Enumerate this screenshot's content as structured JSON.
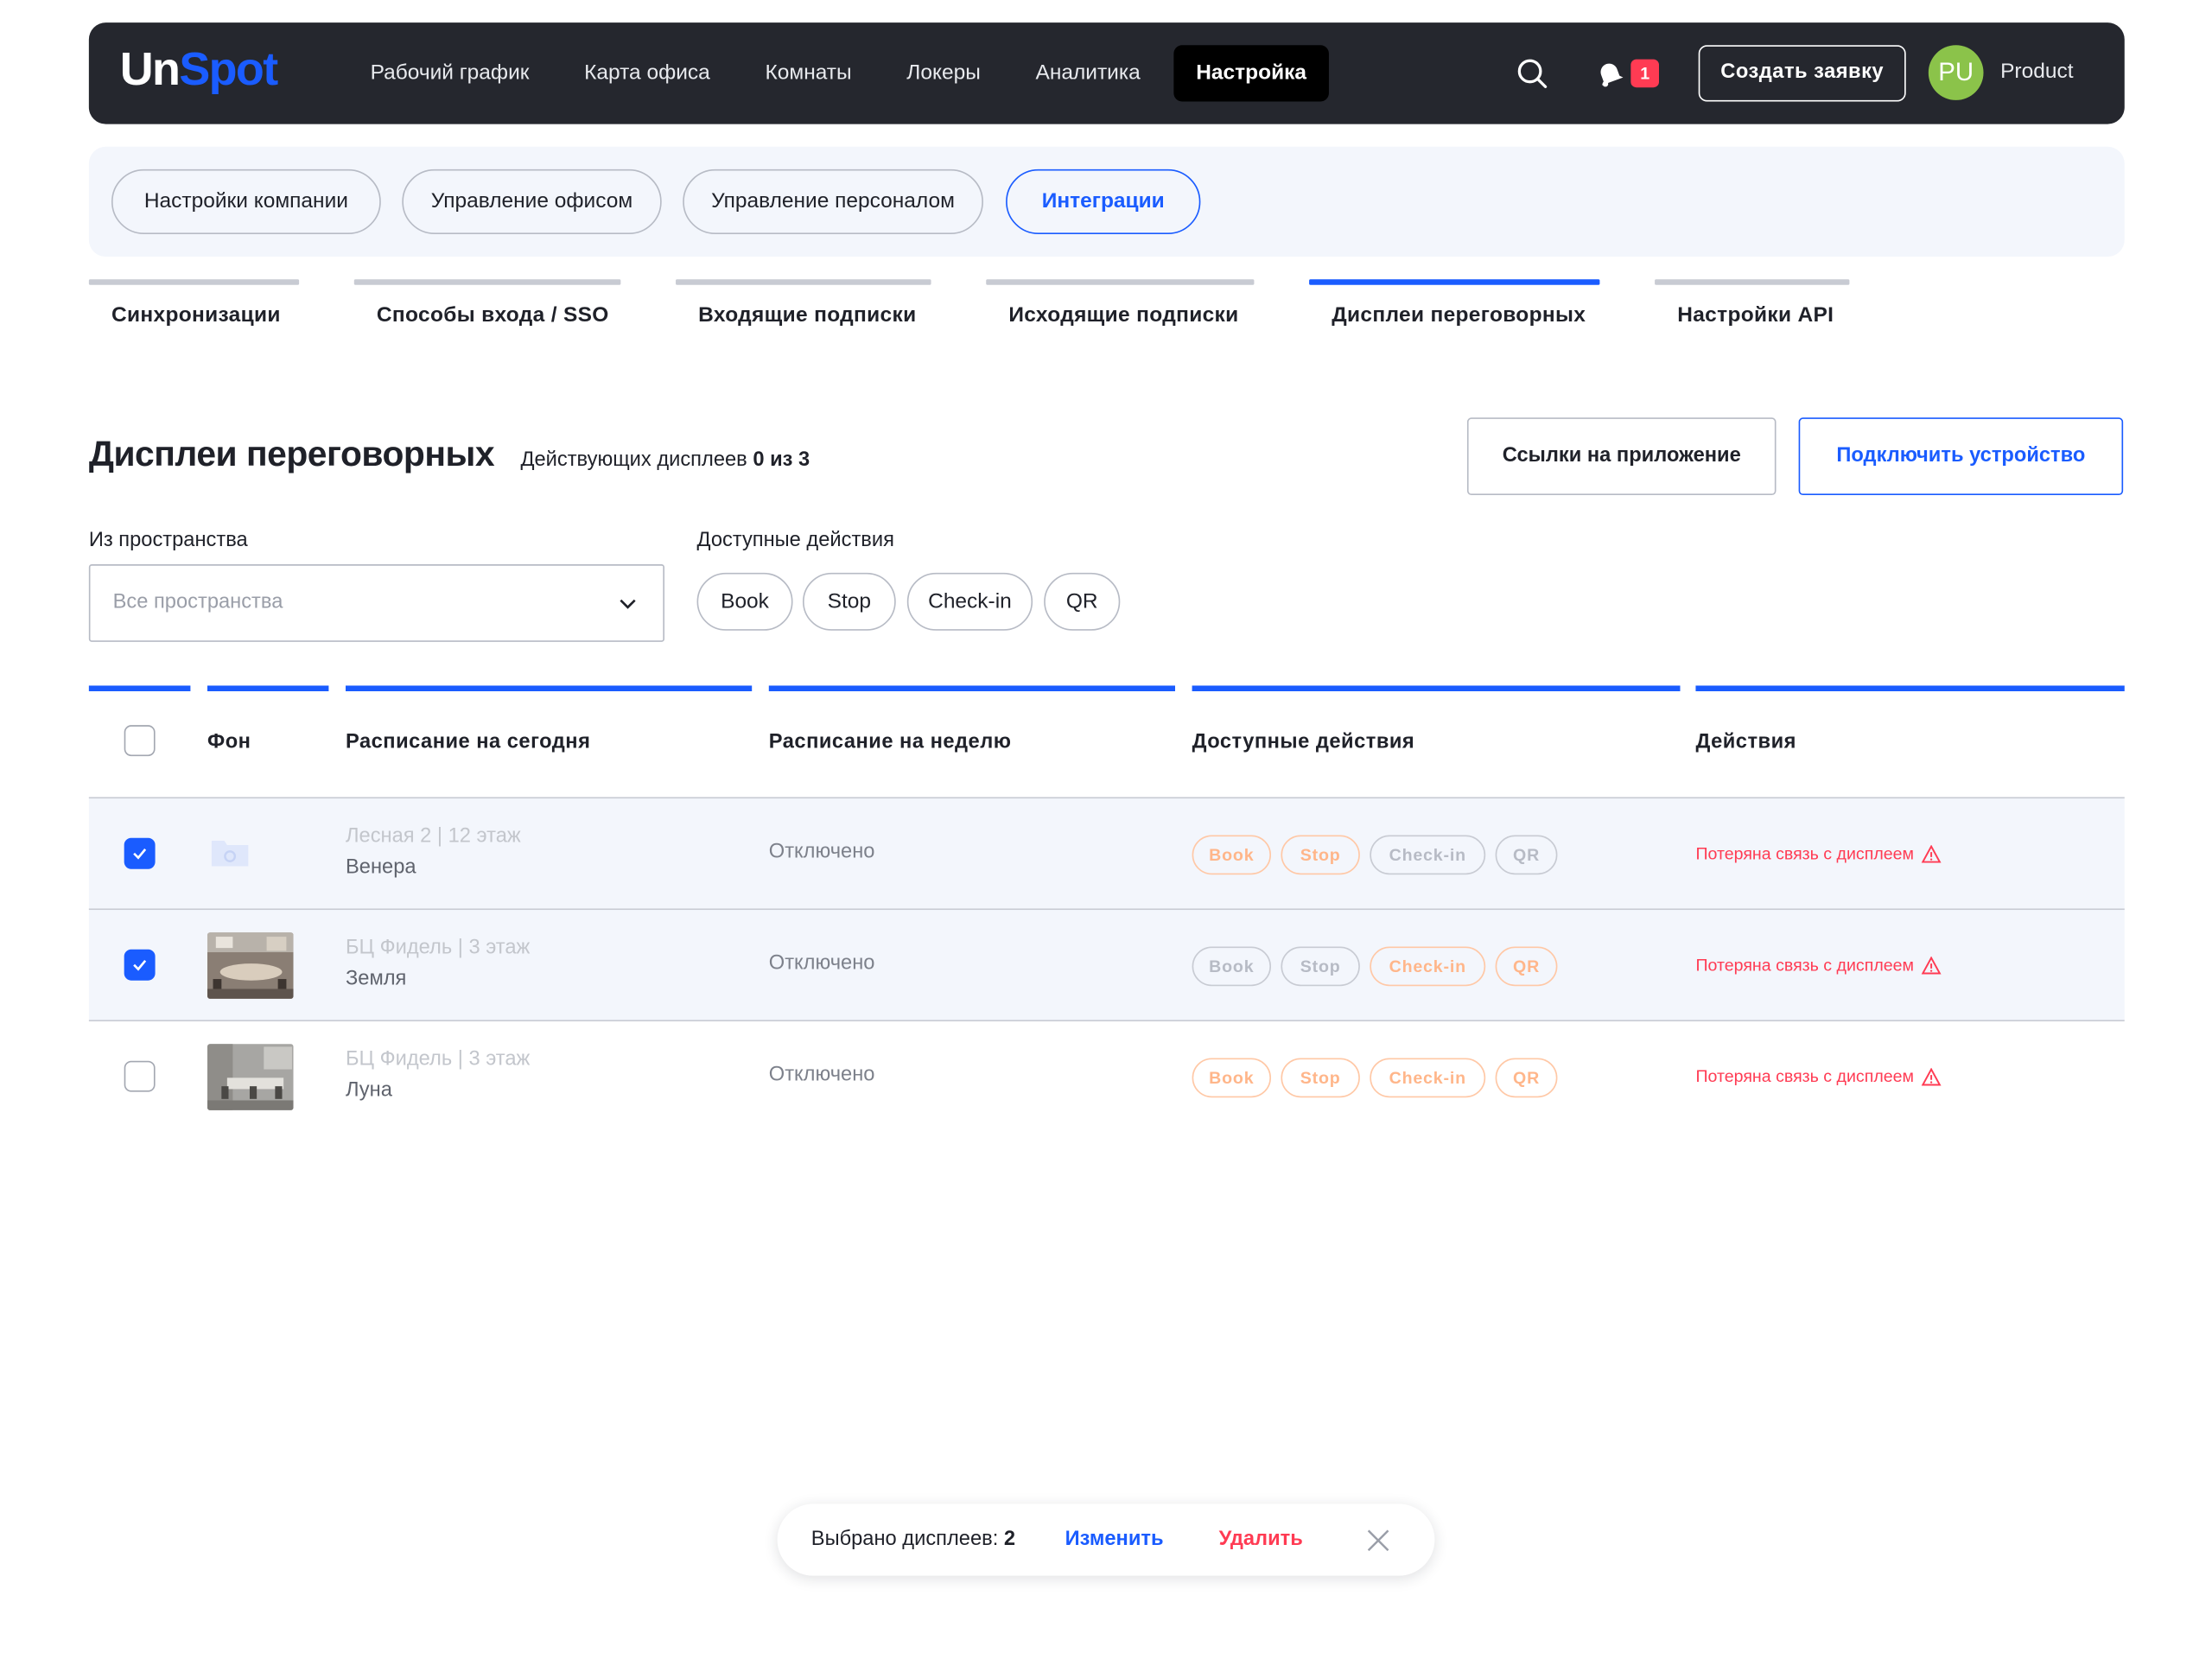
{
  "brand": {
    "logo_un": "Un",
    "logo_spot": "Spot",
    "accent": "#1a5cff",
    "danger": "#ff3b53"
  },
  "nav": {
    "items": [
      "Рабочий график",
      "Карта офиса",
      "Комнаты",
      "Локеры",
      "Аналитика",
      "Настройка"
    ],
    "active": "Настройка",
    "notifications_count": "1",
    "create_button": "Создать заявку",
    "avatar_initials": "PU",
    "user_name": "Product"
  },
  "subnav": {
    "items": [
      "Настройки компании",
      "Управление офисом",
      "Управление персоналом",
      "Интеграции"
    ],
    "active": "Интеграции"
  },
  "section_tabs": {
    "items": [
      "Синхронизации",
      "Способы входа / SSO",
      "Входящие подписки",
      "Исходящие подписки",
      "Дисплеи переговорных",
      "Настройки API"
    ],
    "active": "Дисплеи переговорных"
  },
  "header": {
    "title": "Дисплеи переговорных",
    "active_count_prefix": "Действующих дисплеев",
    "active_count_value": "0 из 3",
    "links_button": "Ссылки на приложение",
    "connect_button": "Подключить устройство"
  },
  "filters": {
    "space_label": "Из пространства",
    "space_placeholder": "Все пространства",
    "actions_label": "Доступные действия",
    "actions": [
      "Book",
      "Stop",
      "Check-in",
      "QR"
    ]
  },
  "table": {
    "columns": [
      "Фон",
      "Расписание на сегодня",
      "Расписание на неделю",
      "Доступные действия",
      "Действия"
    ],
    "rows": [
      {
        "selected": true,
        "location": "Лесная 2 | 12 этаж",
        "room": "Венера",
        "week": "Отключено",
        "actions": [
          "Book",
          "Stop",
          "Check-in",
          "QR"
        ],
        "status": "Потеряна связь с дисплеем"
      },
      {
        "selected": true,
        "location": "БЦ Фидель | 3 этаж",
        "room": "Земля",
        "week": "Отключено",
        "actions": [
          "Book",
          "Stop",
          "Check-in",
          "QR"
        ],
        "status": "Потеряна связь с дисплеем"
      },
      {
        "selected": false,
        "location": "БЦ Фидель | 3 этаж",
        "room": "Луна",
        "week": "Отключено",
        "actions": [
          "Book",
          "Stop",
          "Check-in",
          "QR"
        ],
        "status": "Потеряна связь с дисплеем"
      }
    ]
  },
  "selection_bar": {
    "label": "Выбрано дисплеев:",
    "count": "2",
    "edit": "Изменить",
    "delete": "Удалить"
  }
}
